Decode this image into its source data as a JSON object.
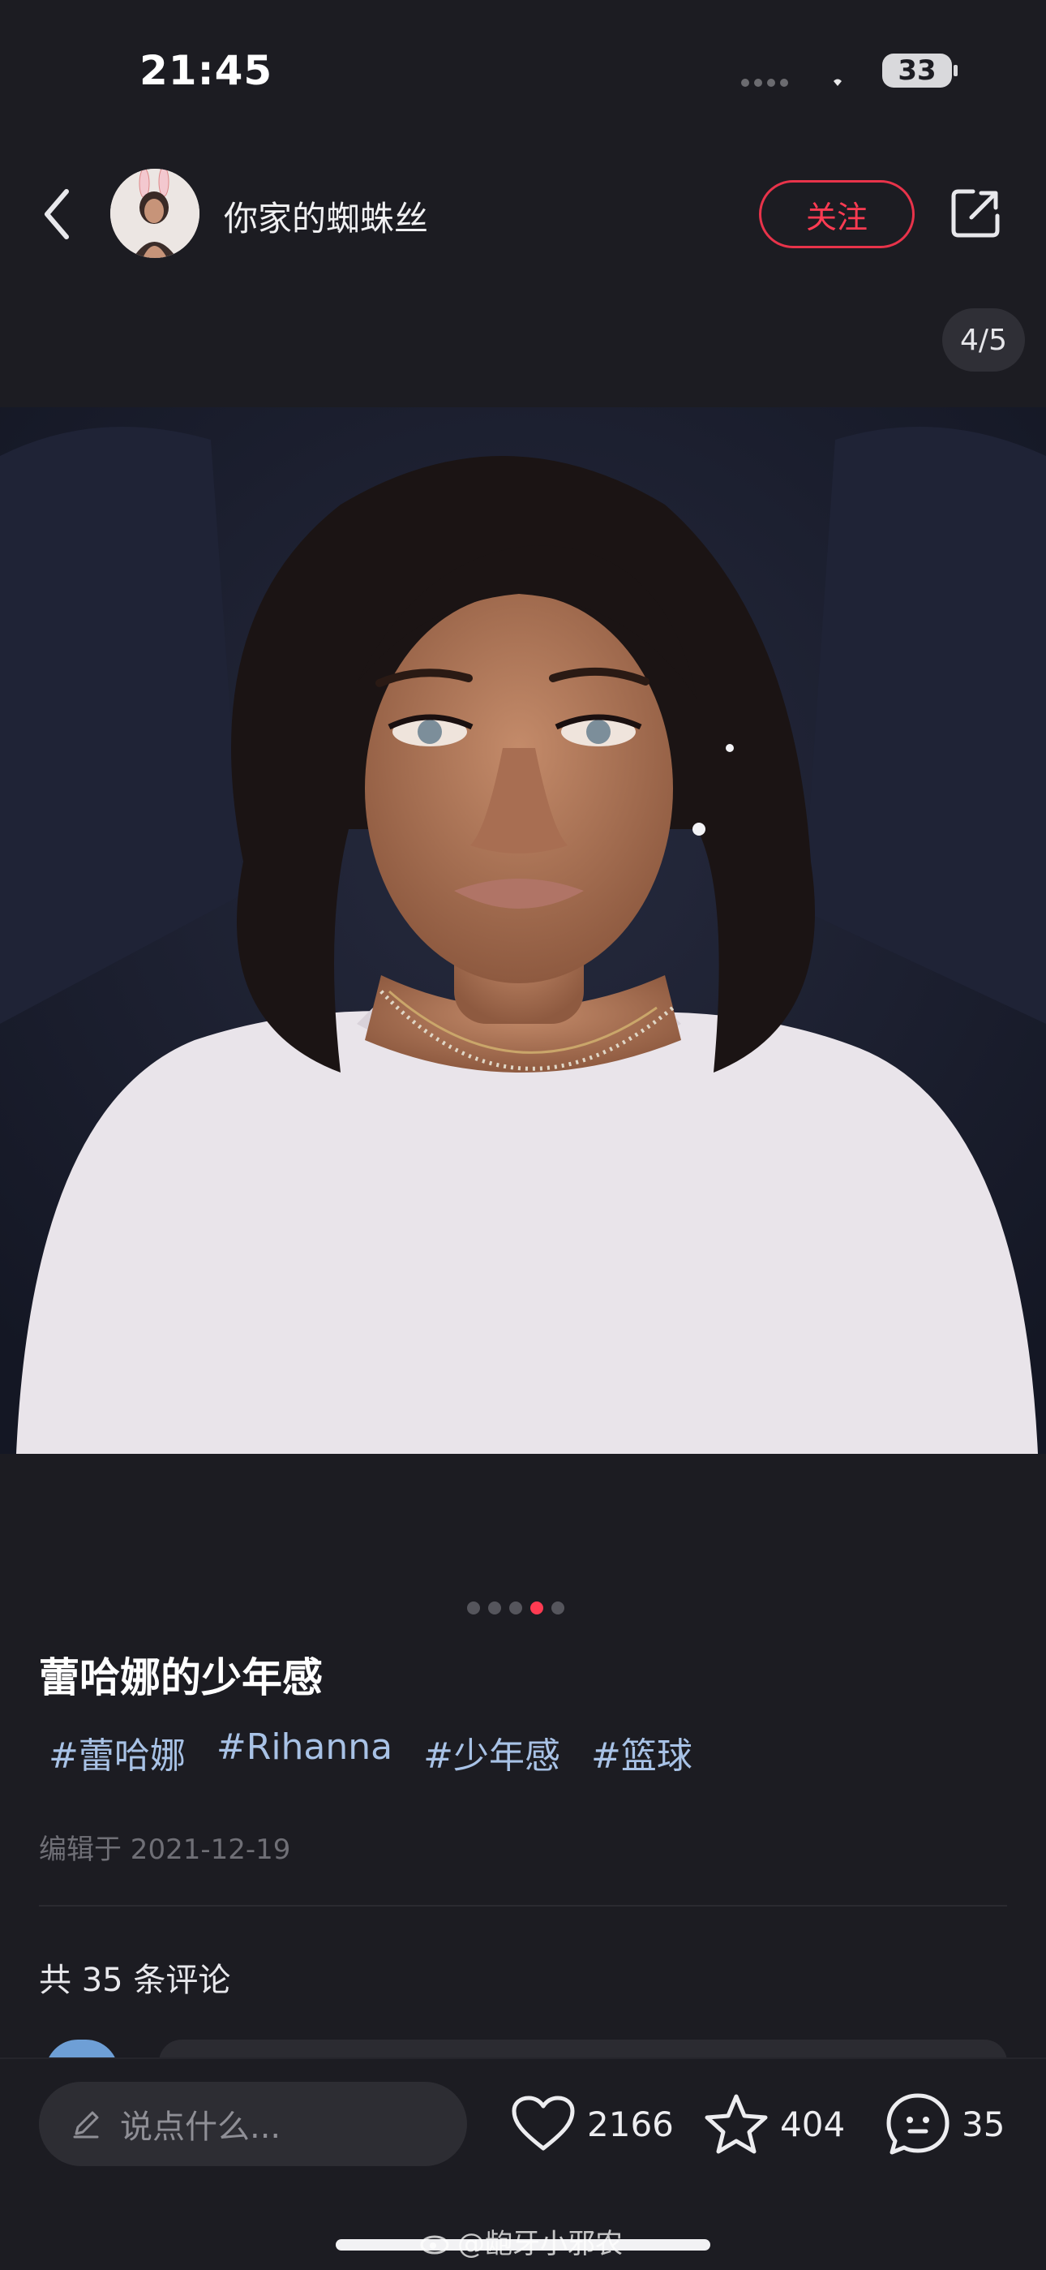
{
  "status_bar": {
    "time": "21:45",
    "battery": "33"
  },
  "header": {
    "author_name": "你家的蜘蛛丝",
    "follow_label": "关注",
    "page_counter": "4/5"
  },
  "gallery": {
    "total_images": 5,
    "current_index": 4
  },
  "post": {
    "title": "蕾哈娜的少年感",
    "tags": [
      "#蕾哈娜",
      "#Rihanna",
      "#少年感",
      "#篮球"
    ],
    "edited": "编辑于 2021-12-19",
    "comment_count_text": "共 35 条评论"
  },
  "bottom_bar": {
    "input_placeholder": "说点什么...",
    "likes": "2166",
    "favorites": "404",
    "comments": "35"
  },
  "watermark": "@龅牙小邪农",
  "colors": {
    "accent": "#ff3b52",
    "tag": "#a8c2e6",
    "background": "#1c1c22"
  }
}
